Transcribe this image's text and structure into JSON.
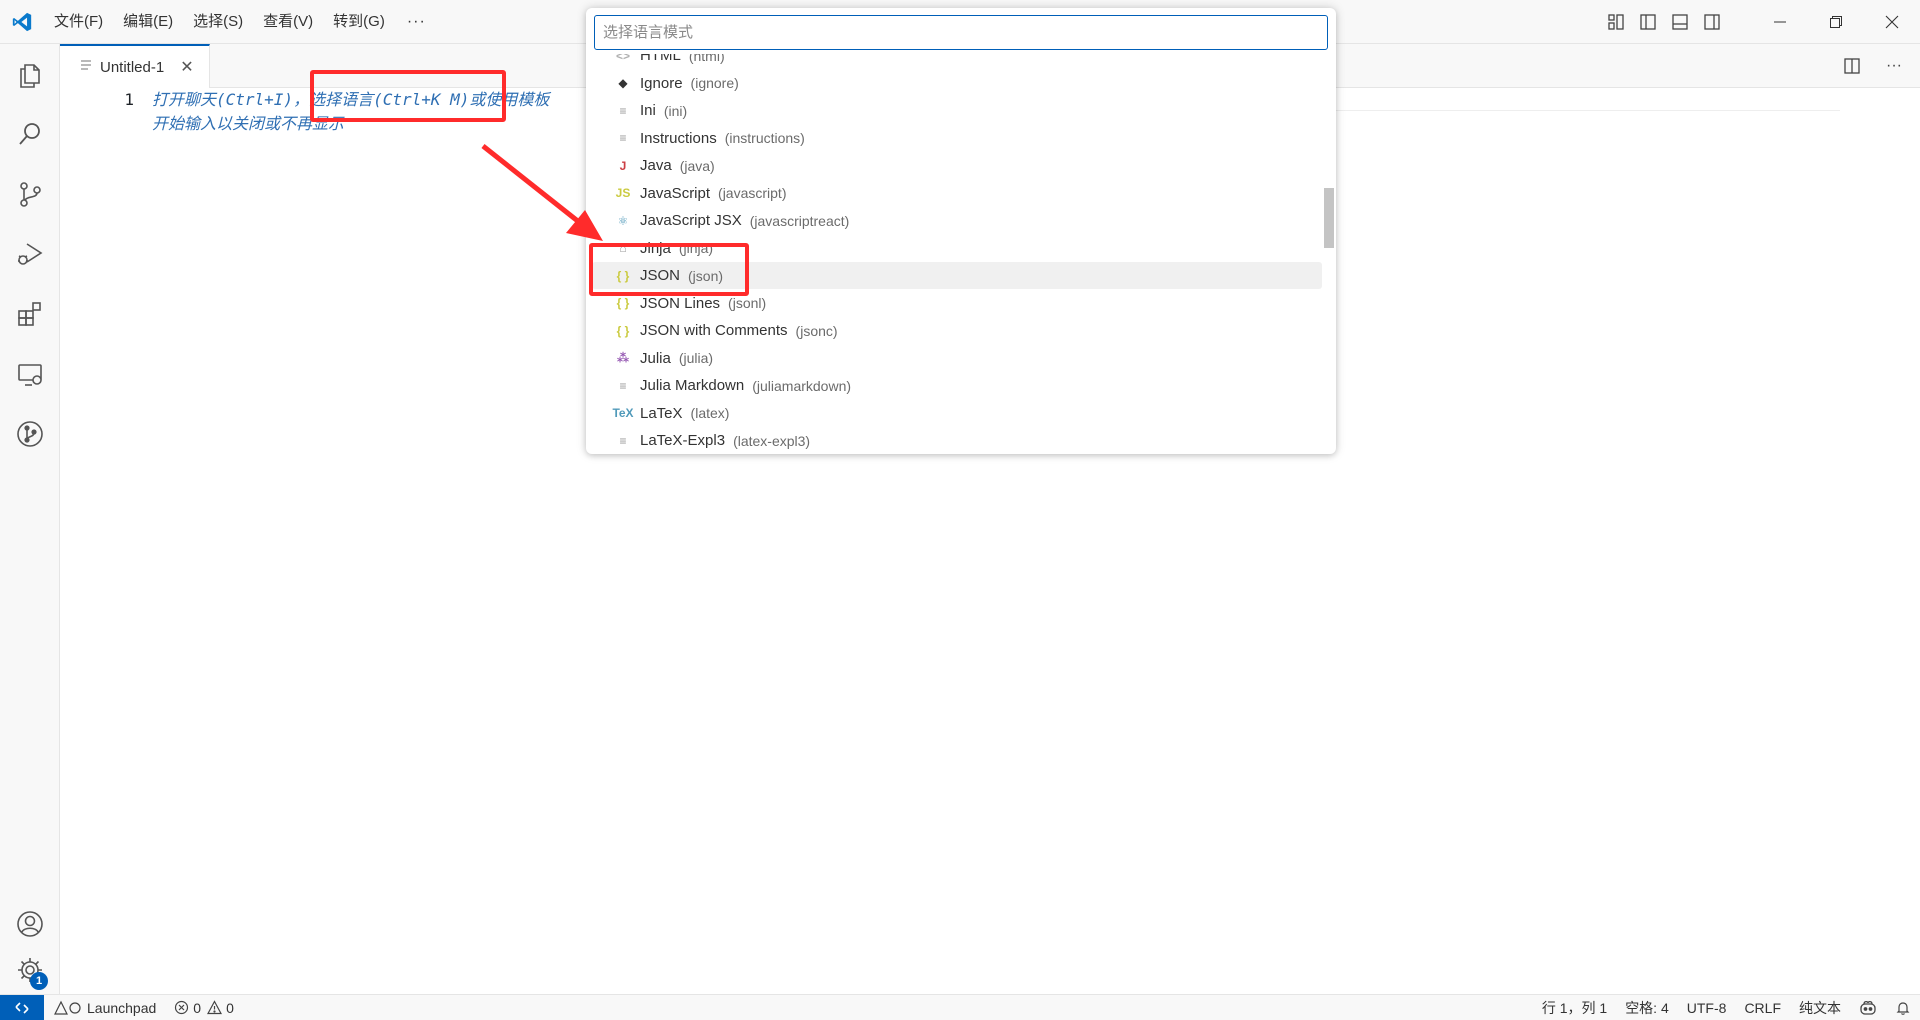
{
  "menu": {
    "items": [
      "文件(F)",
      "编辑(E)",
      "选择(S)",
      "查看(V)",
      "转到(G)"
    ],
    "more": "···"
  },
  "tab": {
    "label": "Untitled-1",
    "close": "✕"
  },
  "editor": {
    "line_number": "1",
    "hint_line1": "打开聊天(Ctrl+I)，选择语言(Ctrl+K M)或使用模板",
    "hint_line2": "开始输入以关闭或不再显示"
  },
  "quick_pick": {
    "placeholder": "选择语言模式",
    "items": [
      {
        "name": "HTML",
        "id": "(html)",
        "icon": "html-icon",
        "glyph": "<>",
        "color": "#b0b0b0"
      },
      {
        "name": "Ignore",
        "id": "(ignore)",
        "icon": "git-diamond-icon",
        "glyph": "◆",
        "color": "#333333"
      },
      {
        "name": "Ini",
        "id": "(ini)",
        "icon": "file-lines-icon",
        "glyph": "≡",
        "color": "#9a9a9a"
      },
      {
        "name": "Instructions",
        "id": "(instructions)",
        "icon": "file-lines-icon",
        "glyph": "≡",
        "color": "#9a9a9a"
      },
      {
        "name": "Java",
        "id": "(java)",
        "icon": "java-icon",
        "glyph": "J",
        "color": "#cc3e44"
      },
      {
        "name": "JavaScript",
        "id": "(javascript)",
        "icon": "javascript-icon",
        "glyph": "JS",
        "color": "#cbcb41"
      },
      {
        "name": "JavaScript JSX",
        "id": "(javascriptreact)",
        "icon": "react-icon",
        "glyph": "⚛",
        "color": "#519aba"
      },
      {
        "name": "Jinja",
        "id": "(jinja)",
        "icon": "jinja-icon",
        "glyph": "⌂",
        "color": "#9a9a9a"
      },
      {
        "name": "JSON",
        "id": "(json)",
        "icon": "braces-icon",
        "glyph": "{ }",
        "color": "#cbcb41"
      },
      {
        "name": "JSON Lines",
        "id": "(jsonl)",
        "icon": "braces-icon",
        "glyph": "{ }",
        "color": "#cbcb41"
      },
      {
        "name": "JSON with Comments",
        "id": "(jsonc)",
        "icon": "braces-icon",
        "glyph": "{ }",
        "color": "#cbcb41"
      },
      {
        "name": "Julia",
        "id": "(julia)",
        "icon": "julia-icon",
        "glyph": "⁂",
        "color": "#9558b2"
      },
      {
        "name": "Julia Markdown",
        "id": "(juliamarkdown)",
        "icon": "file-lines-icon",
        "glyph": "≡",
        "color": "#9a9a9a"
      },
      {
        "name": "LaTeX",
        "id": "(latex)",
        "icon": "tex-icon",
        "glyph": "TeX",
        "color": "#519aba"
      },
      {
        "name": "LaTeX-Expl3",
        "id": "(latex-expl3)",
        "icon": "file-lines-icon",
        "glyph": "≡",
        "color": "#9a9a9a"
      }
    ],
    "selected_index": 8
  },
  "statusbar": {
    "launchpad": "Launchpad",
    "errors": "0",
    "warnings": "0",
    "position": "行 1，列 1",
    "spaces": "空格: 4",
    "encoding": "UTF-8",
    "eol": "CRLF",
    "language": "纯文本"
  },
  "accounts_badge": "1",
  "colors": {
    "accent": "#005fb8",
    "annotation": "#ff2b2b"
  }
}
